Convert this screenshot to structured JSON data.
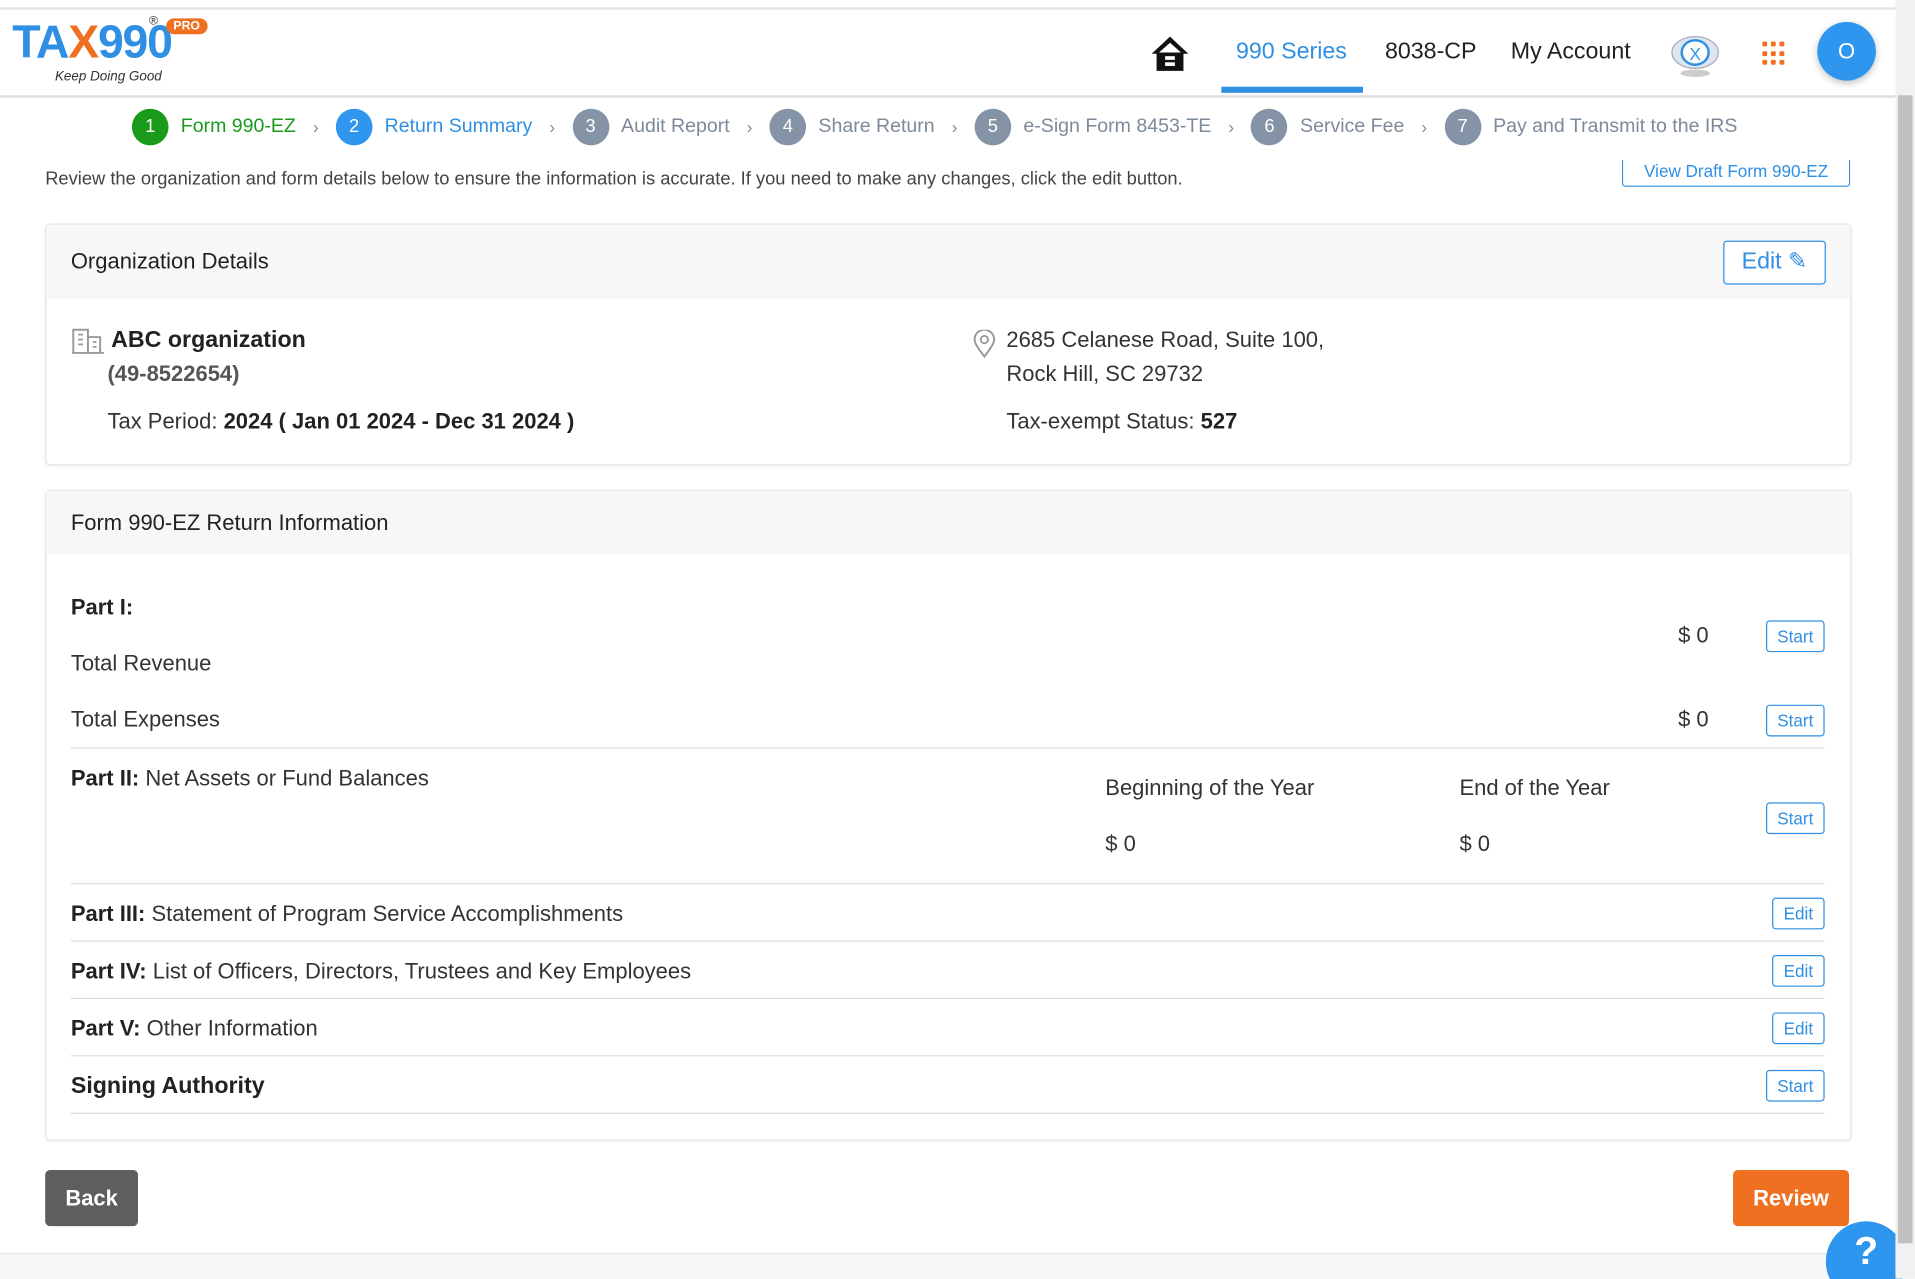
{
  "header": {
    "logo": "TAX990",
    "tagline": "Keep Doing Good",
    "badge": "PRO",
    "nav": [
      {
        "label": "990 Series",
        "active": true
      },
      {
        "label": "8038-CP"
      },
      {
        "label": "My Account"
      }
    ],
    "avatar": "O"
  },
  "steps": [
    {
      "n": "1",
      "label": "Form 990-EZ",
      "state": "done"
    },
    {
      "n": "2",
      "label": "Return Summary",
      "state": "current"
    },
    {
      "n": "3",
      "label": "Audit Report"
    },
    {
      "n": "4",
      "label": "Share Return"
    },
    {
      "n": "5",
      "label": "e-Sign Form 8453-TE"
    },
    {
      "n": "6",
      "label": "Service Fee"
    },
    {
      "n": "7",
      "label": "Pay and Transmit to the IRS"
    }
  ],
  "intro": "Review the organization and form details below to ensure the information is accurate. If you need to make any changes, click the edit button.",
  "view_draft": "View Draft Form 990-EZ",
  "org": {
    "title": "Organization Details",
    "edit": "Edit",
    "name": "ABC organization",
    "ein": "(49-8522654)",
    "tax_period_label": "Tax Period:",
    "tax_period": "2024 ( Jan 01 2024 - Dec 31 2024 )",
    "address1": "2685 Celanese Road, Suite 100,",
    "address2": "Rock Hill, SC 29732",
    "status_label": "Tax-exempt Status:",
    "status": "527"
  },
  "form": {
    "title": "Form 990-EZ Return Information",
    "part1": {
      "label": "Part I:",
      "revenue_label": "Total Revenue",
      "revenue": "$ 0",
      "expenses_label": "Total Expenses",
      "expenses": "$ 0",
      "start": "Start"
    },
    "part2": {
      "label": "Part II:",
      "desc": "Net Assets or Fund Balances",
      "begin_label": "Beginning of the Year",
      "begin": "$ 0",
      "end_label": "End of the Year",
      "end": "$ 0",
      "start": "Start"
    },
    "part3": {
      "label": "Part III:",
      "desc": "Statement of Program Service Accomplishments",
      "btn": "Edit"
    },
    "part4": {
      "label": "Part IV:",
      "desc": "List of Officers, Directors, Trustees and Key Employees",
      "btn": "Edit"
    },
    "part5": {
      "label": "Part V:",
      "desc": "Other Information",
      "btn": "Edit"
    },
    "signing": {
      "label": "Signing Authority",
      "btn": "Start"
    }
  },
  "footer": {
    "back": "Back",
    "review": "Review",
    "help": "?"
  },
  "colors": {
    "accent": "#2f8fe3",
    "orange": "#f07022",
    "green": "#1a9a1a"
  }
}
